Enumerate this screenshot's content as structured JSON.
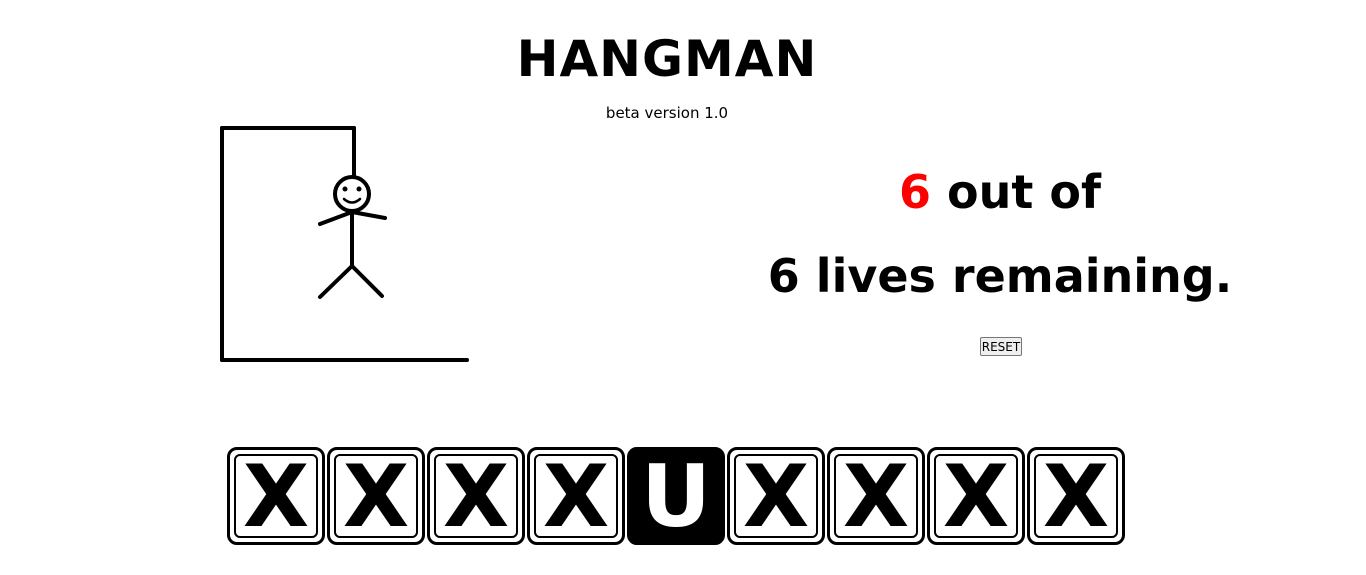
{
  "game": {
    "title": "HANGMAN",
    "subtitle": "beta version 1.0",
    "lives_remaining": "6",
    "lives_middle": "out of",
    "lives_total_text": "6 lives remaining.",
    "reset_label": "RESET",
    "word_tiles": [
      {
        "letter": "X",
        "revealed": false
      },
      {
        "letter": "X",
        "revealed": false
      },
      {
        "letter": "X",
        "revealed": false
      },
      {
        "letter": "X",
        "revealed": false
      },
      {
        "letter": "U",
        "revealed": true
      },
      {
        "letter": "X",
        "revealed": false
      },
      {
        "letter": "X",
        "revealed": false
      },
      {
        "letter": "X",
        "revealed": false
      },
      {
        "letter": "X",
        "revealed": false
      }
    ]
  },
  "colors": {
    "lives_number": "#ff0000",
    "tile_revealed_bg": "#000000",
    "tile_hidden_bg": "#ffffff"
  }
}
